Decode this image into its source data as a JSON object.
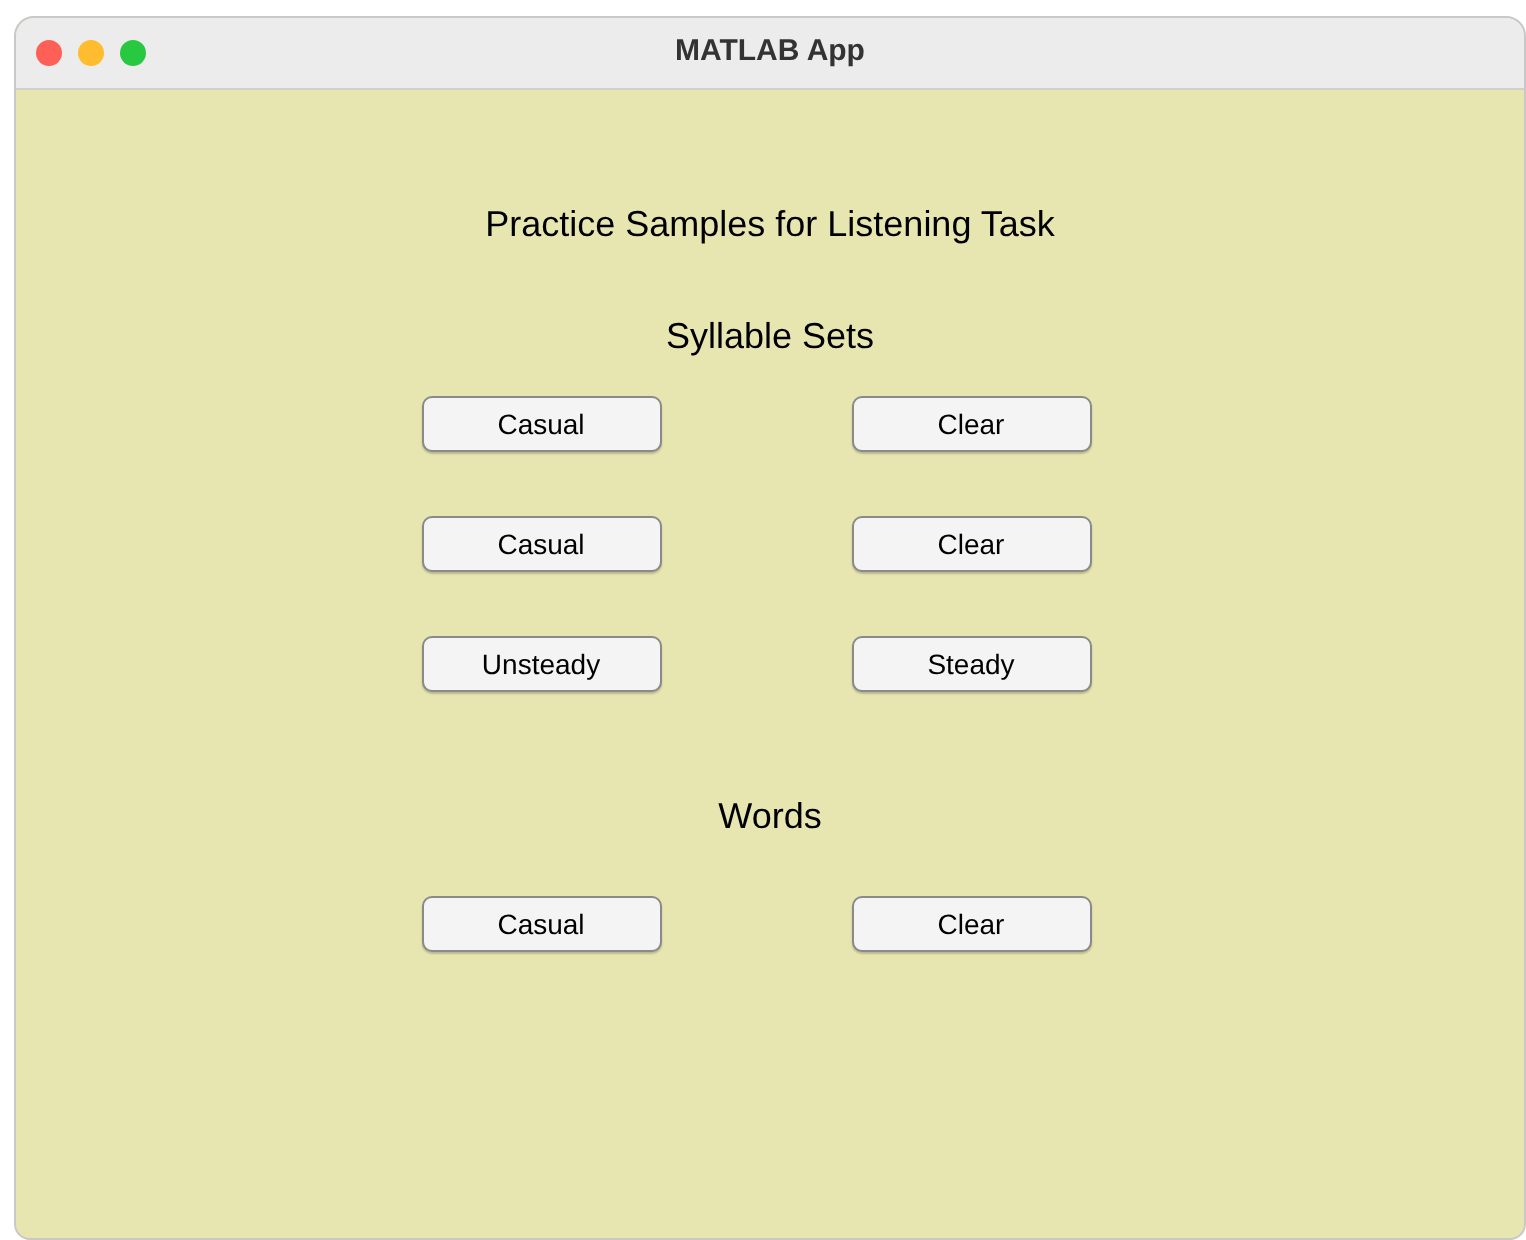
{
  "window": {
    "title": "MATLAB App"
  },
  "heading": "Practice Samples for Listening Task",
  "sections": [
    {
      "title": "Syllable Sets",
      "rows": [
        [
          "Casual",
          "Clear"
        ],
        [
          "Casual",
          "Clear"
        ],
        [
          "Unsteady",
          "Steady"
        ]
      ]
    },
    {
      "title": "Words",
      "rows": [
        [
          "Casual",
          "Clear"
        ]
      ]
    }
  ]
}
